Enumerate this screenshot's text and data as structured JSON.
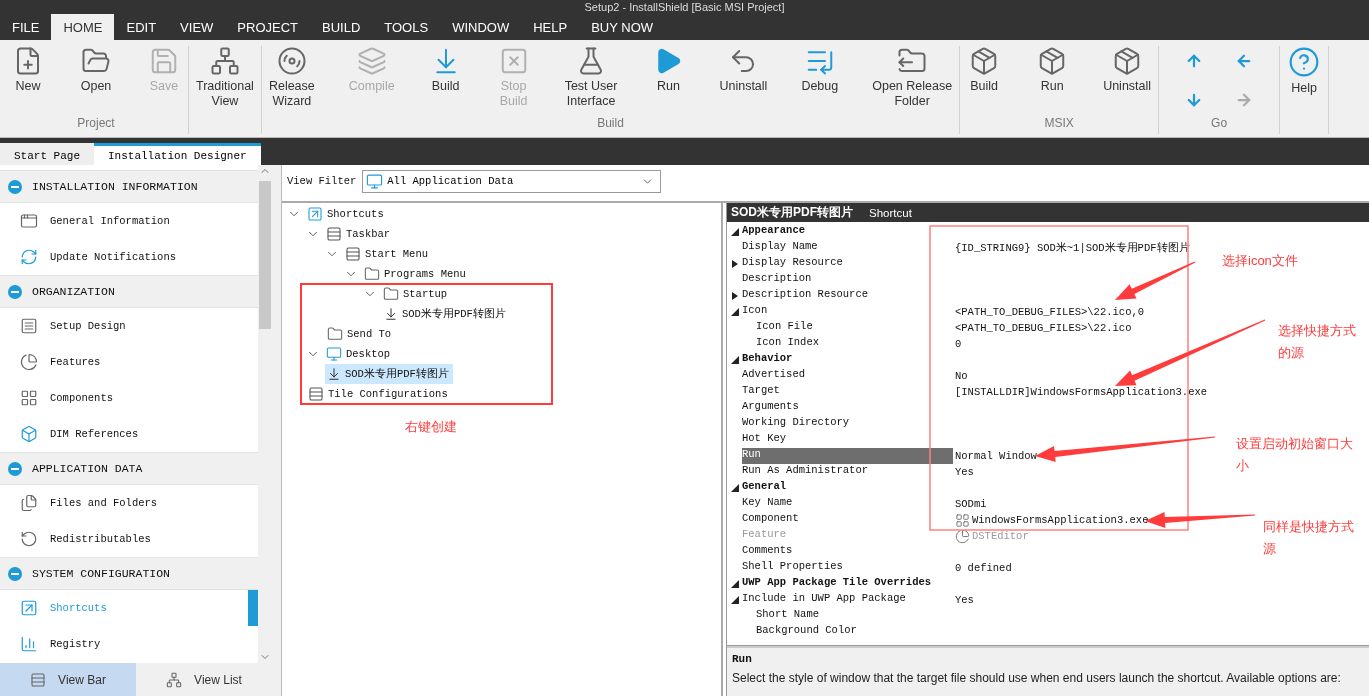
{
  "window": {
    "title": "Setup2 - InstallShield [Basic MSI Project]"
  },
  "menu": [
    {
      "label": "FILE",
      "selected": false
    },
    {
      "label": "HOME",
      "selected": true
    },
    {
      "label": "EDIT",
      "selected": false
    },
    {
      "label": "VIEW",
      "selected": false
    },
    {
      "label": "PROJECT",
      "selected": false
    },
    {
      "label": "BUILD",
      "selected": false
    },
    {
      "label": "TOOLS",
      "selected": false
    },
    {
      "label": "WINDOW",
      "selected": false
    },
    {
      "label": "HELP",
      "selected": false
    },
    {
      "label": "BUY NOW",
      "selected": false
    }
  ],
  "ribbon": [
    {
      "label": "Project",
      "kind": "large",
      "buttons": [
        {
          "label": "New",
          "kind": "new",
          "disabled": false
        },
        {
          "label": "Open",
          "kind": "open",
          "disabled": false
        },
        {
          "label": "Save",
          "kind": "save",
          "disabled": true
        }
      ]
    },
    {
      "kind": "large",
      "buttons": [
        {
          "label": "Traditional\nView",
          "kind": "tree",
          "disabled": false
        }
      ]
    },
    {
      "label": "Build",
      "kind": "large",
      "buttons": [
        {
          "label": "Release\nWizard",
          "kind": "disc",
          "disabled": false
        },
        {
          "label": "Compile",
          "kind": "layers",
          "disabled": true
        },
        {
          "label": "Build",
          "kind": "build",
          "disabled": false
        },
        {
          "label": "Stop\nBuild",
          "kind": "stop",
          "disabled": true
        },
        {
          "label": "Test User\nInterface",
          "kind": "flask",
          "disabled": false
        },
        {
          "label": "Run",
          "kind": "run",
          "disabled": false
        },
        {
          "label": "Uninstall",
          "kind": "uninstall",
          "disabled": false
        },
        {
          "label": "Debug",
          "kind": "debug",
          "disabled": false
        },
        {
          "label": "Open Release\nFolder",
          "kind": "folder",
          "disabled": false
        }
      ]
    },
    {
      "label": "MSIX",
      "kind": "large",
      "buttons": [
        {
          "label": "Build",
          "kind": "package",
          "disabled": false
        },
        {
          "label": "Run",
          "kind": "package",
          "disabled": false
        },
        {
          "label": "Uninstall",
          "kind": "package",
          "disabled": false
        }
      ]
    },
    {
      "label": "Go",
      "kind": "small",
      "buttons": [
        {
          "kind": "up",
          "disabled": false
        },
        {
          "kind": "left",
          "disabled": false
        },
        {
          "kind": "down",
          "disabled": false
        },
        {
          "kind": "right",
          "disabled": true
        }
      ]
    },
    {
      "kind": "large",
      "buttons": [
        {
          "label": "Help",
          "kind": "help",
          "disabled": false
        }
      ]
    }
  ],
  "documents": [
    {
      "label": "Start Page",
      "selected": false
    },
    {
      "label": "Installation Designer",
      "selected": true
    }
  ],
  "sidebar": {
    "sections": [
      {
        "title": "INSTALLATION INFORMATION",
        "items": [
          {
            "label": "General Information",
            "kind": "window",
            "selected": false
          },
          {
            "label": "Update Notifications",
            "kind": "refresh",
            "selected": false
          }
        ]
      },
      {
        "title": "ORGANIZATION",
        "items": [
          {
            "label": "Setup Design",
            "kind": "design",
            "selected": false
          },
          {
            "label": "Features",
            "kind": "pie",
            "selected": false
          },
          {
            "label": "Components",
            "kind": "grid",
            "selected": false
          },
          {
            "label": "DIM References",
            "kind": "cube",
            "selected": false
          }
        ]
      },
      {
        "title": "APPLICATION DATA",
        "items": [
          {
            "label": "Files and Folders",
            "kind": "files",
            "selected": false
          },
          {
            "label": "Redistributables",
            "kind": "rotate",
            "selected": false
          }
        ]
      },
      {
        "title": "SYSTEM CONFIGURATION",
        "items": [
          {
            "label": "Shortcuts",
            "kind": "shortcut",
            "selected": true
          },
          {
            "label": "Registry",
            "kind": "registry",
            "selected": false
          }
        ]
      }
    ],
    "tabs": [
      {
        "label": "View Bar",
        "selected": true
      },
      {
        "label": "View List",
        "selected": false
      }
    ]
  },
  "view_filter": {
    "label": "View Filter",
    "value": "All Application Data"
  },
  "tree": [
    {
      "label": "Shortcuts",
      "kind": "shortcut",
      "expanded": true,
      "selected": false,
      "children": [
        {
          "label": "Taskbar",
          "kind": "list",
          "expanded": true,
          "selected": false,
          "children": [
            {
              "label": "Start Menu",
              "kind": "list",
              "expanded": true,
              "selected": false,
              "children": [
                {
                  "label": "Programs Menu",
                  "kind": "folder",
                  "expanded": true,
                  "selected": false,
                  "children": [
                    {
                      "label": "Startup",
                      "kind": "folder",
                      "expanded": true,
                      "selected": false,
                      "children": [
                        {
                          "label": "SOD米专用PDF转图片",
                          "kind": "link",
                          "selected": false
                        }
                      ]
                    }
                  ]
                }
              ]
            },
            {
              "label": "Send To",
              "kind": "folder",
              "selected": false
            }
          ]
        },
        {
          "label": "Desktop",
          "kind": "monitor",
          "expanded": true,
          "selected": false,
          "children": [
            {
              "label": "SOD米专用PDF转图片",
              "kind": "link",
              "selected": true
            }
          ]
        },
        {
          "label": "Tile Configurations",
          "kind": "list",
          "selected": false
        }
      ]
    }
  ],
  "properties": {
    "title": "SOD米专用PDF转图片",
    "subtitle": "Shortcut",
    "categories": [
      {
        "label": "Appearance",
        "expanded": true,
        "children": [
          {
            "label": "Display Name",
            "value": "{ID_STRING9} SOD米~1|SOD米专用PDF转图片",
            "selected": false,
            "disabled": false
          },
          {
            "label": "Display Resource",
            "expanded": false,
            "selected": false,
            "disabled": false
          },
          {
            "label": "Description",
            "selected": false,
            "disabled": false
          },
          {
            "label": "Description Resource",
            "expanded": false,
            "selected": false,
            "disabled": false
          },
          {
            "label": "Icon",
            "value": "<PATH_TO_DEBUG_FILES>\\22.ico,0",
            "expanded": true,
            "selected": false,
            "disabled": false,
            "children": [
              {
                "label": "Icon File",
                "value": "<PATH_TO_DEBUG_FILES>\\22.ico",
                "selected": false,
                "disabled": false
              },
              {
                "label": "Icon Index",
                "value": "0",
                "selected": false,
                "disabled": false
              }
            ]
          }
        ]
      },
      {
        "label": "Behavior",
        "expanded": true,
        "children": [
          {
            "label": "Advertised",
            "value": "No",
            "selected": false,
            "disabled": false
          },
          {
            "label": "Target",
            "value": "[INSTALLDIR]WindowsFormsApplication3.exe",
            "selected": false,
            "disabled": false
          },
          {
            "label": "Arguments",
            "selected": false,
            "disabled": false
          },
          {
            "label": "Working Directory",
            "selected": false,
            "disabled": false
          },
          {
            "label": "Hot Key",
            "selected": false,
            "disabled": false
          },
          {
            "label": "Run",
            "value": "Normal Window",
            "selected": true,
            "disabled": false
          },
          {
            "label": "Run As Administrator",
            "value": "Yes",
            "selected": false,
            "disabled": false
          }
        ]
      },
      {
        "label": "General",
        "expanded": true,
        "children": [
          {
            "label": "Key Name",
            "value": "SODmi",
            "selected": false,
            "disabled": false
          },
          {
            "label": "Component",
            "value": "WindowsFormsApplication3.exe",
            "kind": "component",
            "selected": false,
            "disabled": false
          },
          {
            "label": "Feature",
            "value": "DSTEditor",
            "kind": "feature",
            "selected": false,
            "disabled": true
          },
          {
            "label": "Comments",
            "selected": false,
            "disabled": false
          },
          {
            "label": "Shell Properties",
            "value": "0 defined",
            "selected": false,
            "disabled": false
          }
        ]
      },
      {
        "label": "UWP App Package Tile Overrides",
        "expanded": true,
        "children": [
          {
            "label": "Include in UWP App Package",
            "value": "Yes",
            "expanded": true,
            "selected": false,
            "disabled": false,
            "children": [
              {
                "label": "Short Name",
                "selected": false,
                "disabled": false
              },
              {
                "label": "Background Color",
                "selected": false,
                "disabled": false
              }
            ]
          }
        ]
      }
    ],
    "help": {
      "title": "Run",
      "text": "Select the style of window that the target file should use when end users launch the shortcut. Available options are:"
    }
  },
  "annotations": [
    "右键创建",
    "选择icon文件",
    "选择快捷方式的源",
    "设置启动初始窗口大小",
    "同样是快捷方式源"
  ]
}
